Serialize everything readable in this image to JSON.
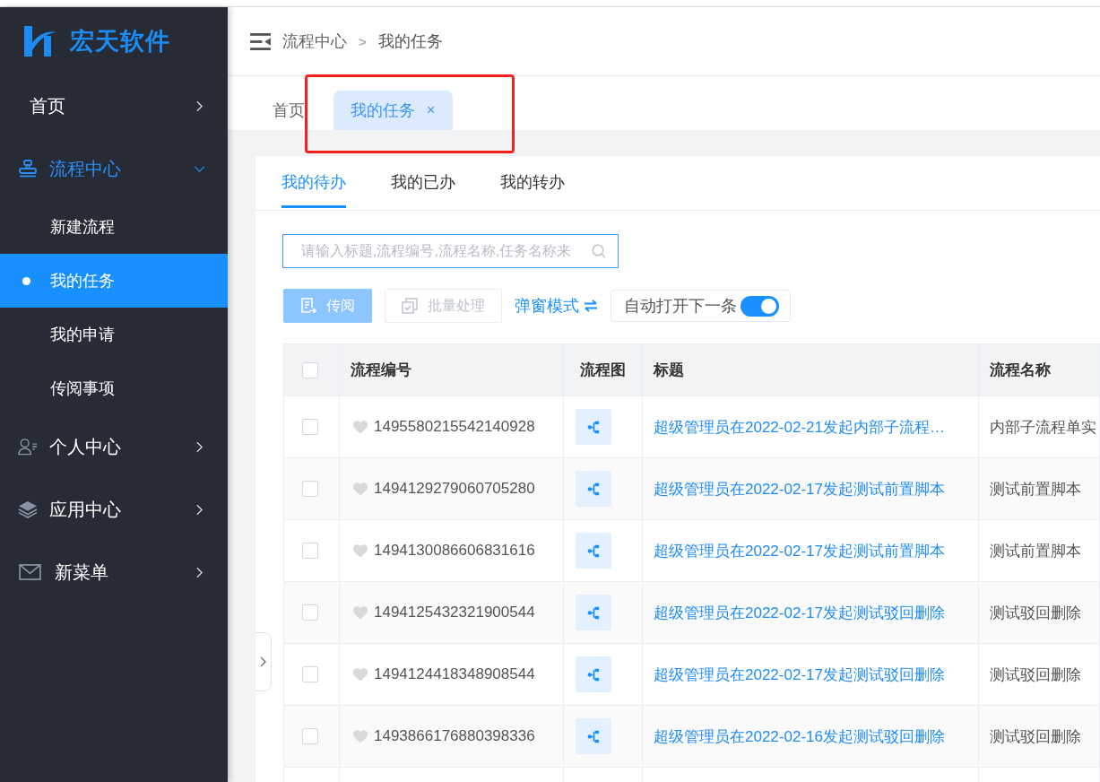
{
  "sidebar": {
    "logo": "宏天软件",
    "items": [
      {
        "label": "首页",
        "active": false,
        "expanded": false
      },
      {
        "label": "流程中心",
        "active": true,
        "expanded": true,
        "children": [
          {
            "label": "新建流程",
            "selected": false
          },
          {
            "label": "我的任务",
            "selected": true
          },
          {
            "label": "我的申请",
            "selected": false
          },
          {
            "label": "传阅事项",
            "selected": false
          }
        ]
      },
      {
        "label": "个人中心",
        "active": false,
        "expanded": false
      },
      {
        "label": "应用中心",
        "active": false,
        "expanded": false
      },
      {
        "label": "新菜单",
        "active": false,
        "expanded": false
      }
    ]
  },
  "header": {
    "breadcrumb": [
      {
        "label": "流程中心"
      },
      {
        "label": "我的任务"
      }
    ],
    "separator": ">"
  },
  "page_tabs": [
    {
      "label": "首页",
      "selected": false
    },
    {
      "label": "我的任务",
      "selected": true,
      "close": "×"
    }
  ],
  "content_tabs": [
    {
      "label": "我的待办",
      "selected": true
    },
    {
      "label": "我的已办",
      "selected": false
    },
    {
      "label": "我的转办",
      "selected": false
    }
  ],
  "search": {
    "placeholder": "请输入标题,流程编号,流程名称,任务名称来"
  },
  "toolbar": {
    "buttons": [
      {
        "label": "传阅",
        "kind": "primary",
        "disabled": true
      },
      {
        "label": "批量处理",
        "kind": "plain",
        "disabled": true
      }
    ],
    "mode_link": "弹窗模式",
    "auto_next": {
      "label": "自动打开下一条",
      "on": true
    }
  },
  "table": {
    "select_all": {
      "checked": false
    },
    "columns": [
      "流程编号",
      "流程图",
      "标题",
      "流程名称"
    ],
    "rows": [
      {
        "checked": false,
        "favorite": false,
        "id": "1495580215542140928",
        "title": "超级管理员在2022-02-21发起内部子流程…",
        "name": "内部子流程单实"
      },
      {
        "checked": false,
        "favorite": false,
        "id": "1494129279060705280",
        "title": "超级管理员在2022-02-17发起测试前置脚本",
        "name": "测试前置脚本"
      },
      {
        "checked": false,
        "favorite": false,
        "id": "1494130086606831616",
        "title": "超级管理员在2022-02-17发起测试前置脚本",
        "name": "测试前置脚本"
      },
      {
        "checked": false,
        "favorite": false,
        "id": "1494125432321900544",
        "title": "超级管理员在2022-02-17发起测试驳回删除",
        "name": "测试驳回删除"
      },
      {
        "checked": false,
        "favorite": false,
        "id": "1494124418348908544",
        "title": "超级管理员在2022-02-17发起测试驳回删除",
        "name": "测试驳回删除"
      },
      {
        "checked": false,
        "favorite": false,
        "id": "1493866176880398336",
        "title": "超级管理员在2022-02-16发起测试驳回删除",
        "name": "测试驳回删除"
      }
    ]
  }
}
